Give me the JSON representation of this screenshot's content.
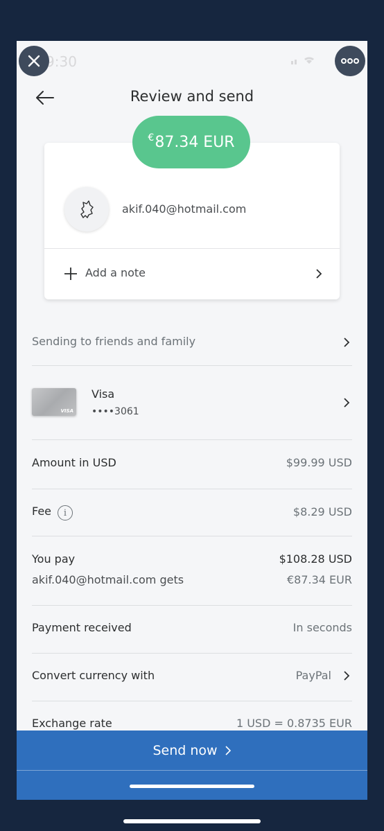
{
  "status": {
    "time": "9:30"
  },
  "header": {
    "title": "Review and send"
  },
  "amount": {
    "currency_symbol": "€",
    "value": "87.34 EUR"
  },
  "recipient": {
    "email": "akif.040@hotmail.com"
  },
  "note": {
    "label": "Add a note"
  },
  "rows": {
    "sending_to": "Sending to friends and family",
    "card": {
      "name": "Visa",
      "number": "••••3061",
      "brand": "VISA"
    },
    "amount_usd": {
      "label": "Amount in USD",
      "value": "$99.99 USD"
    },
    "fee": {
      "label": "Fee",
      "value": "$8.29 USD",
      "info": "i"
    },
    "you_pay": {
      "label": "You pay",
      "value": "$108.28 USD",
      "gets_label": "akif.040@hotmail.com gets",
      "gets_value": "€87.34 EUR"
    },
    "payment_received": {
      "label": "Payment received",
      "value": "In seconds"
    },
    "convert": {
      "label": "Convert currency with",
      "value": "PayPal"
    },
    "exchange": {
      "label": "Exchange rate",
      "value": "1 USD = 0.8735 EUR"
    }
  },
  "send": {
    "label": "Send now"
  },
  "colors": {
    "accent_green": "#59c68e",
    "button_blue": "#2f6fbd",
    "background": "#f5f6f8",
    "frame": "#16263f"
  },
  "icons": [
    "close-icon",
    "more-icon",
    "back-arrow-icon",
    "avatar-icon",
    "plus-icon",
    "chevron-right-icon",
    "info-icon"
  ]
}
